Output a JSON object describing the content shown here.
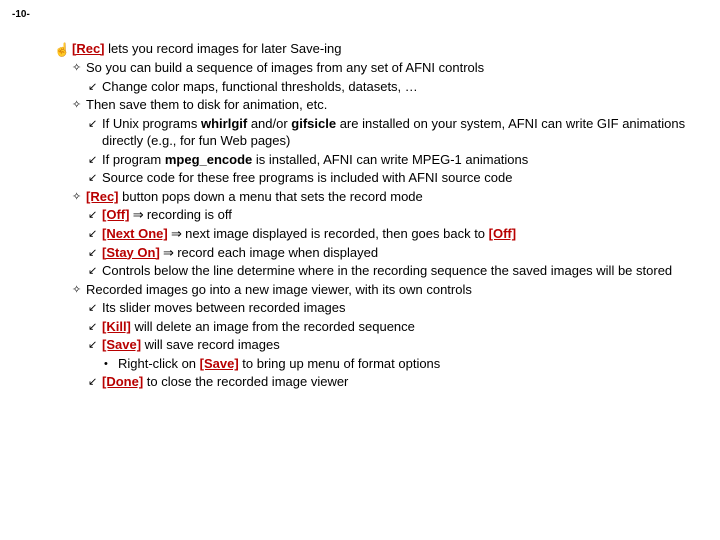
{
  "page_number": "-10-",
  "lines": [
    {
      "level": "hand",
      "parts": [
        {
          "t": "btn",
          "v": "[Rec]"
        },
        {
          "t": "txt",
          "v": " lets you record images for later Save-ing"
        }
      ]
    },
    {
      "level": "diamond",
      "parts": [
        {
          "t": "txt",
          "v": "So you can build a sequence of images from any set of AFNI controls"
        }
      ]
    },
    {
      "level": "arrow",
      "parts": [
        {
          "t": "txt",
          "v": "Change color maps, functional thresholds, datasets, …"
        }
      ]
    },
    {
      "level": "diamond",
      "parts": [
        {
          "t": "txt",
          "v": "Then save them to disk for animation, etc."
        }
      ]
    },
    {
      "level": "arrow",
      "parts": [
        {
          "t": "txt",
          "v": "If Unix programs "
        },
        {
          "t": "bold",
          "v": "whirlgif"
        },
        {
          "t": "txt",
          "v": " and/or "
        },
        {
          "t": "bold",
          "v": "gifsicle"
        },
        {
          "t": "txt",
          "v": " are installed on your system, AFNI can write GIF animations directly (e.g., for fun Web pages)"
        }
      ]
    },
    {
      "level": "arrow",
      "parts": [
        {
          "t": "txt",
          "v": "If program "
        },
        {
          "t": "bold",
          "v": "mpeg_encode"
        },
        {
          "t": "txt",
          "v": " is installed, AFNI can write MPEG-1 animations"
        }
      ]
    },
    {
      "level": "arrow",
      "parts": [
        {
          "t": "txt",
          "v": "Source code for these free programs is included with AFNI source code"
        }
      ]
    },
    {
      "level": "diamond",
      "parts": [
        {
          "t": "btn",
          "v": "[Rec]"
        },
        {
          "t": "txt",
          "v": " button pops down a menu that sets the record mode"
        }
      ]
    },
    {
      "level": "arrow",
      "parts": [
        {
          "t": "btn",
          "v": "[Off]"
        },
        {
          "t": "arrow",
          "v": " ⇒ "
        },
        {
          "t": "txt",
          "v": "recording is off"
        }
      ]
    },
    {
      "level": "arrow",
      "parts": [
        {
          "t": "btn",
          "v": "[Next One]"
        },
        {
          "t": "arrow",
          "v": " ⇒ "
        },
        {
          "t": "txt",
          "v": "next image displayed is recorded, then goes back to "
        },
        {
          "t": "btn",
          "v": "[Off]"
        }
      ]
    },
    {
      "level": "arrow",
      "parts": [
        {
          "t": "btn",
          "v": "[Stay On]"
        },
        {
          "t": "arrow",
          "v": " ⇒ "
        },
        {
          "t": "txt",
          "v": "record each image when displayed"
        }
      ]
    },
    {
      "level": "arrow",
      "parts": [
        {
          "t": "txt",
          "v": "Controls below the line determine where in the recording sequence the saved images will be stored"
        }
      ]
    },
    {
      "level": "diamond",
      "parts": [
        {
          "t": "txt",
          "v": "Recorded images go into a new image viewer, with its own controls"
        }
      ]
    },
    {
      "level": "arrow",
      "parts": [
        {
          "t": "txt",
          "v": "Its slider moves between recorded images"
        }
      ]
    },
    {
      "level": "arrow",
      "parts": [
        {
          "t": "btn",
          "v": "[Kill]"
        },
        {
          "t": "txt",
          "v": " will delete an image from the recorded sequence"
        }
      ]
    },
    {
      "level": "arrow",
      "parts": [
        {
          "t": "btn",
          "v": "[Save]"
        },
        {
          "t": "txt",
          "v": " will save record images"
        }
      ]
    },
    {
      "level": "dot",
      "parts": [
        {
          "t": "txt",
          "v": "Right-click on "
        },
        {
          "t": "btn",
          "v": "[Save]"
        },
        {
          "t": "txt",
          "v": " to bring up menu of format options"
        }
      ]
    },
    {
      "level": "arrow",
      "parts": [
        {
          "t": "btn",
          "v": "[Done]"
        },
        {
          "t": "txt",
          "v": " to close the recorded image viewer"
        }
      ]
    }
  ],
  "bullets": {
    "hand": "☝",
    "diamond": "✧",
    "arrow": "↙",
    "dot": "•"
  }
}
